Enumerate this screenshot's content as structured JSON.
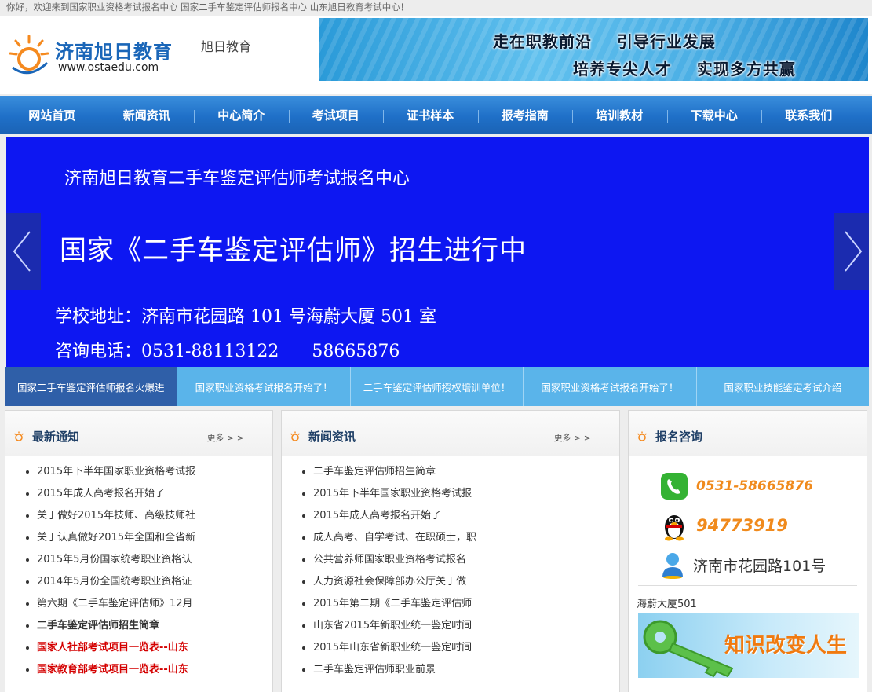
{
  "topbar": {
    "text": "你好，欢迎来到国家职业资格考试报名中心 国家二手车鉴定评估师报名中心 山东旭日教育考试中心！"
  },
  "header": {
    "logo_name": "济南旭日教育",
    "logo_url": "www.ostaedu.com",
    "brand": "旭日教育",
    "banner_line1": "走在职教前沿    引导行业发展",
    "banner_line2": "培养专尖人才    实现多方共赢"
  },
  "nav": {
    "items": [
      "网站首页",
      "新闻资讯",
      "中心简介",
      "考试项目",
      "证书样本",
      "报考指南",
      "培训教材",
      "下载中心",
      "联系我们"
    ]
  },
  "slide": {
    "title": "济南旭日教育二手车鉴定评估师考试报名中心",
    "headline": "国家《二手车鉴定评估师》招生进行中",
    "address": "学校地址：济南市花园路 101 号海蔚大厦 501 室",
    "tel": "咨询电话：0531-88113122      58665876"
  },
  "thumbs": [
    "国家二手车鉴定评估师报名火爆进",
    "国家职业资格考试报名开始了！",
    "二手车鉴定评估师授权培训单位！",
    "国家职业资格考试报名开始了！",
    "国家职业技能鉴定考试介绍"
  ],
  "notices": {
    "title": "最新通知",
    "more": "更多 > >",
    "items": [
      "2015年下半年国家职业资格考试报",
      "2015年成人高考报名开始了",
      "关于做好2015年技师、高级技师社",
      "关于认真做好2015年全国和全省新",
      "2015年5月份国家统考职业资格认",
      "2014年5月份全国统考职业资格证",
      "第六期《二手车鉴定评估师》12月",
      "二手车鉴定评估师招生简章",
      "国家人社部考试项目一览表--山东",
      "国家教育部考试项目一览表--山东"
    ]
  },
  "news": {
    "title": "新闻资讯",
    "more": "更多 > >",
    "items": [
      "二手车鉴定评估师招生简章",
      "2015年下半年国家职业资格考试报",
      "2015年成人高考报名开始了",
      "成人高考、自学考试、在职硕士，职",
      "公共营养师国家职业资格考试报名",
      "人力资源社会保障部办公厅关于做",
      "2015年第二期《二手车鉴定评估师",
      "山东省2015年新职业统一鉴定时间",
      "2015年山东省新职业统一鉴定时间",
      "二手车鉴定评估师职业前景"
    ]
  },
  "consult": {
    "title": "报名咨询",
    "phone": "0531-58665876",
    "qq": "94773919",
    "address": "济南市花园路101号",
    "address2": "海蔚大厦501",
    "promo": "知识改变人生"
  },
  "colors": {
    "nav": "#1f70c8",
    "slide": "#0d17f2",
    "accent": "#f08a1c",
    "red": "#d40000"
  }
}
